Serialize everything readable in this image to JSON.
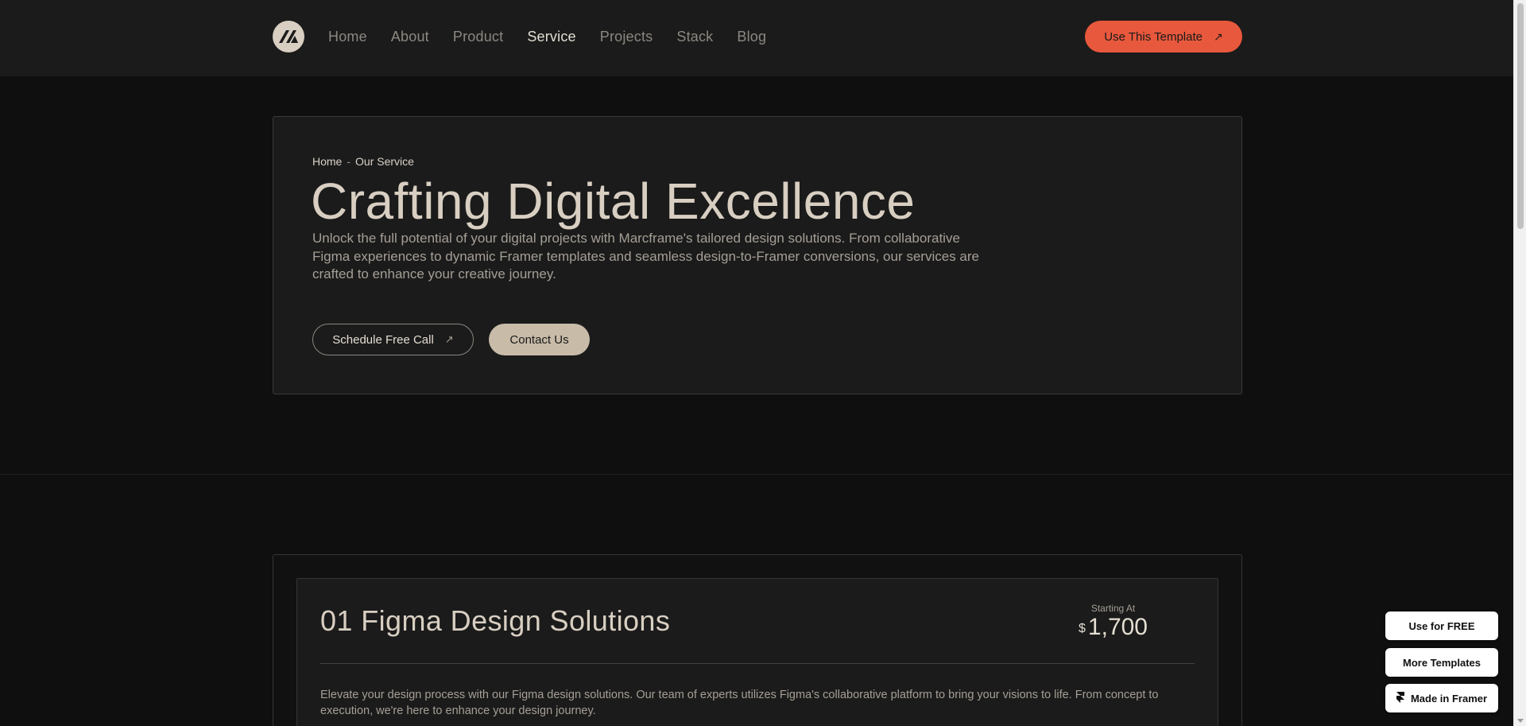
{
  "header": {
    "nav": [
      "Home",
      "About",
      "Product",
      "Service",
      "Projects",
      "Stack",
      "Blog"
    ],
    "active_nav": "Service",
    "cta_label": "Use This Template"
  },
  "hero": {
    "breadcrumb": {
      "home": "Home",
      "sep": "-",
      "current": "Our Service"
    },
    "title": "Crafting Digital Excellence",
    "description": "Unlock the full potential of your digital projects with Marcframe's tailored design solutions. From collaborative Figma experiences to dynamic Framer templates and seamless design-to-Framer conversions, our services are crafted to enhance your creative journey.",
    "btn_schedule": "Schedule Free Call",
    "btn_contact": "Contact Us"
  },
  "service": {
    "title": "01 Figma Design Solutions",
    "price_label": "Starting At",
    "currency": "$",
    "price": "1,700",
    "description": "Elevate your design process with our Figma design solutions. Our team of experts utilizes Figma's collaborative platform to bring your visions to life. From concept to execution, we're here to enhance your design journey."
  },
  "framer_badges": {
    "use_free": "Use for FREE",
    "more_templates": "More Templates",
    "made_in": "Made in Framer"
  },
  "colors": {
    "accent": "#e8583c",
    "header_bg": "#1b1b1b",
    "page_bg": "#0f0f0f",
    "beige": "#c8bba8"
  },
  "icons": {
    "logo": "marcframe-logo-icon",
    "arrow": "arrow-up-right-icon",
    "framer": "framer-icon"
  }
}
